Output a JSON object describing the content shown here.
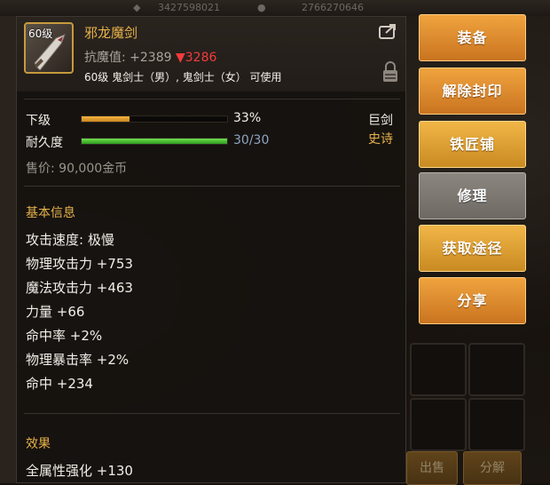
{
  "item": {
    "level_badge": "60级",
    "name": "邪龙魔剑",
    "resist_label": "抗魔值:",
    "resist_value": "+2389",
    "resist_down": "▼3286",
    "usable_by": "60级 鬼剑士（男）, 鬼剑士（女） 可使用"
  },
  "grade": {
    "label": "下级",
    "percent": 33,
    "value_text": "33%"
  },
  "durability": {
    "label": "耐久度",
    "current": 30,
    "max": 30,
    "value_text": "30/30"
  },
  "type_tag": "巨剑",
  "rarity_tag": "史诗",
  "price_text": "售价: 90,000金币",
  "basic_info": {
    "title": "基本信息",
    "lines": [
      "攻击速度: 极慢",
      "物理攻击力 +753",
      "魔法攻击力 +463",
      "力量 +66",
      "命中率 +2%",
      "物理暴击率 +2%",
      "命中 +234"
    ]
  },
  "effects": {
    "title": "效果",
    "lines": [
      "全属性强化 +130"
    ]
  },
  "buttons": [
    "装备",
    "解除封印",
    "铁匠铺",
    "修理",
    "获取途径",
    "分享"
  ],
  "background": {
    "topbar_numbers": [
      "3427598021",
      "2766270646"
    ],
    "bottom_buttons": [
      "出售",
      "分解"
    ]
  },
  "colors": {
    "accent": "#e7b24a",
    "down": "#f23b3b",
    "durability": "#4cc03a",
    "grade": "#f0a33e"
  }
}
